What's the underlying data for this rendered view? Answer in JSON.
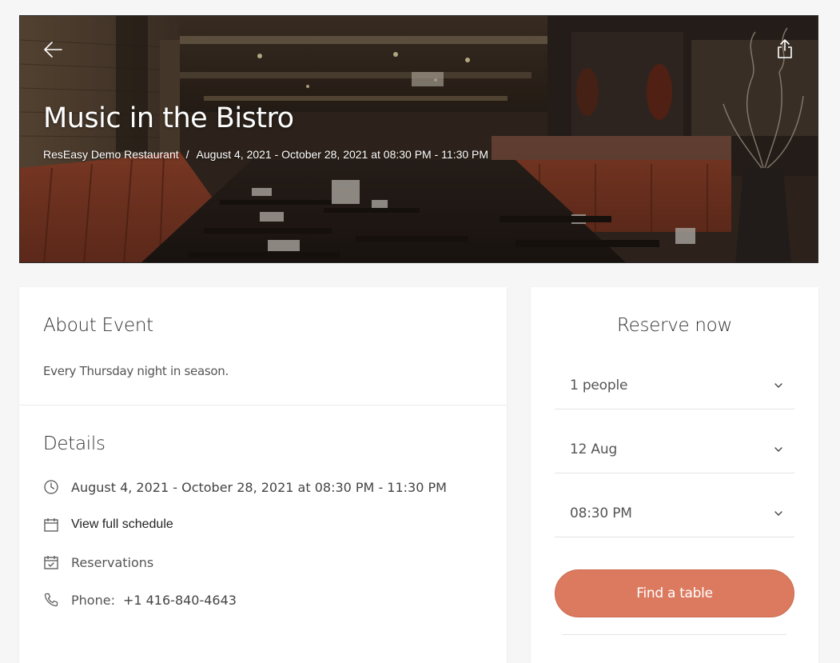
{
  "hero": {
    "title": "Music in the Bistro",
    "restaurant": "ResEasy Demo Restaurant",
    "separator": "/",
    "date_range": "August 4, 2021 - October 28, 2021 at 08:30 PM - 11:30 PM",
    "back_icon": "arrow-left-icon",
    "share_icon": "share-icon"
  },
  "about": {
    "title": "About Event",
    "description": "Every Thursday night in season."
  },
  "details": {
    "title": "Details",
    "schedule_text": "August 4, 2021 - October 28, 2021 at 08:30 PM - 11:30 PM",
    "full_schedule_link": "View full schedule",
    "reservations_label": "Reservations",
    "phone_label": "Phone:",
    "phone_value": "+1 416-840-4643"
  },
  "reserve": {
    "title": "Reserve now",
    "party_size": "1 people",
    "date": "12 Aug",
    "time": "08:30 PM",
    "button_label": "Find a table"
  },
  "colors": {
    "accent": "#dc7a5f",
    "background": "#f6f6f6",
    "card": "#ffffff"
  }
}
